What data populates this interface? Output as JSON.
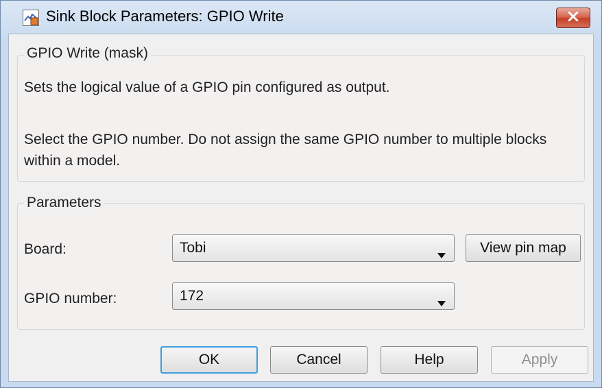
{
  "window": {
    "title": "Sink Block Parameters: GPIO Write"
  },
  "mask_group": {
    "legend": "GPIO Write (mask)",
    "description_1": "Sets the logical value of a GPIO pin configured as output.",
    "description_2": "Select the GPIO number. Do not assign the same GPIO number to multiple blocks within a model."
  },
  "parameters_group": {
    "legend": "Parameters",
    "board_label": "Board:",
    "board_value": "Tobi",
    "view_pin_map_label": "View pin map",
    "gpio_label": "GPIO number:",
    "gpio_value": "172"
  },
  "buttons": {
    "ok": "OK",
    "cancel": "Cancel",
    "help": "Help",
    "apply": "Apply"
  },
  "icons": {
    "app": "simulink-block-icon",
    "close": "close-icon",
    "dropdown": "chevron-down-icon"
  },
  "colors": {
    "close_button": "#c44128",
    "default_button_border": "#3c9ee0"
  }
}
